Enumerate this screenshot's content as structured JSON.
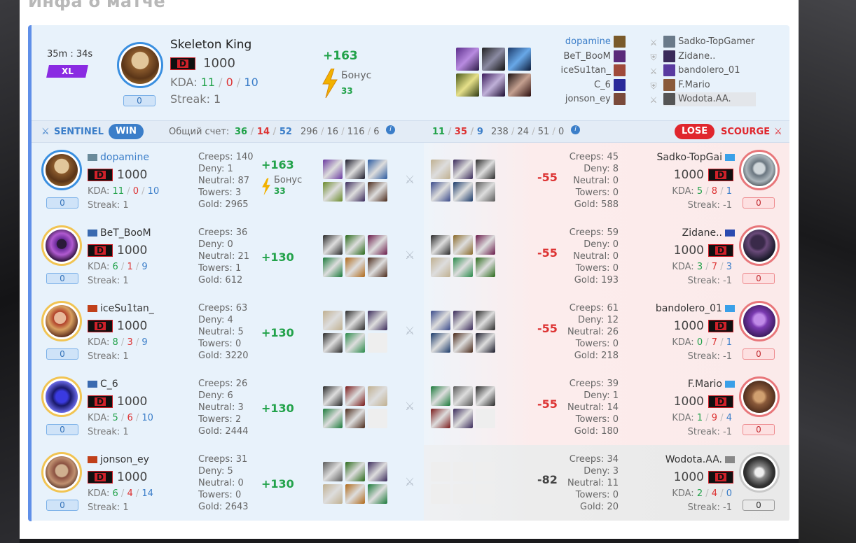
{
  "page_title": "Инфа о матче",
  "summary": {
    "duration": "35m : 34s",
    "xl_label": "XL",
    "hero_name": "Skeleton King",
    "rank_letter": "D",
    "rating": "1000",
    "kda_label": "KDA:",
    "kda": {
      "k": "11",
      "d": "0",
      "a": "10"
    },
    "streak": "Streak: 1",
    "level": "0",
    "points": "+163",
    "bonus_label": "Бонус",
    "bonus_value": "33"
  },
  "roster": {
    "sentinel": [
      "dopamine",
      "BeT_BooM",
      "iceSu1tan_",
      "C_6",
      "jonson_ey"
    ],
    "scourge": [
      "Sadko-TopGamer",
      "Zidane..",
      "bandolero_01",
      "F.Mario",
      "Wodota.AA."
    ]
  },
  "header": {
    "sentinel_label": "SENTINEL",
    "win_label": "WIN",
    "score_label": "Общий счет:",
    "sentinel_kda": {
      "k": "36",
      "d": "14",
      "a": "52"
    },
    "sentinel_stats": {
      "c": "296",
      "d": "16",
      "n": "116",
      "t": "6"
    },
    "scourge_kda": {
      "k": "11",
      "d": "35",
      "a": "9"
    },
    "scourge_stats": {
      "c": "238",
      "d": "24",
      "n": "51",
      "t": "0"
    },
    "lose_label": "LOSE",
    "scourge_label": "SCOURGE"
  },
  "labels": {
    "creeps": "Creeps:",
    "deny": "Deny:",
    "neutral": "Neutral:",
    "towers": "Towers:",
    "gold": "Gold:",
    "kda": "KDA:",
    "streak": "Streak:",
    "bonus": "Бонус"
  },
  "players": [
    {
      "left": {
        "name": "dopamine",
        "rank": "D",
        "rating": "1000",
        "k": "11",
        "d": "0",
        "a": "10",
        "streak": "1",
        "level": "0",
        "creeps": "140",
        "deny": "1",
        "neutral": "87",
        "towers": "3",
        "gold": "2965"
      },
      "delta": "+163",
      "bonus": "33",
      "rdelta": "-55",
      "right": {
        "name": "Sadko-TopGai",
        "rank": "D",
        "rating": "1000",
        "k": "5",
        "d": "8",
        "a": "1",
        "streak": "-1",
        "level": "0",
        "creeps": "45",
        "deny": "8",
        "neutral": "0",
        "towers": "0",
        "gold": "588"
      }
    },
    {
      "left": {
        "name": "BeT_BooM",
        "rank": "D",
        "rating": "1000",
        "k": "6",
        "d": "1",
        "a": "9",
        "streak": "1",
        "level": "0",
        "creeps": "36",
        "deny": "0",
        "neutral": "21",
        "towers": "1",
        "gold": "612"
      },
      "delta": "+130",
      "rdelta": "-55",
      "right": {
        "name": "Zidane..",
        "rank": "D",
        "rating": "1000",
        "k": "3",
        "d": "7",
        "a": "3",
        "streak": "-1",
        "level": "0",
        "creeps": "59",
        "deny": "0",
        "neutral": "0",
        "towers": "0",
        "gold": "193"
      }
    },
    {
      "left": {
        "name": "iceSu1tan_",
        "rank": "D",
        "rating": "1000",
        "k": "8",
        "d": "3",
        "a": "9",
        "streak": "1",
        "level": "0",
        "creeps": "63",
        "deny": "4",
        "neutral": "5",
        "towers": "0",
        "gold": "3220"
      },
      "delta": "+130",
      "rdelta": "-55",
      "right": {
        "name": "bandolero_01",
        "rank": "D",
        "rating": "1000",
        "k": "0",
        "d": "7",
        "a": "1",
        "streak": "-1",
        "level": "0",
        "creeps": "61",
        "deny": "12",
        "neutral": "26",
        "towers": "0",
        "gold": "218"
      }
    },
    {
      "left": {
        "name": "C_6",
        "rank": "D",
        "rating": "1000",
        "k": "5",
        "d": "6",
        "a": "10",
        "streak": "1",
        "level": "0",
        "creeps": "26",
        "deny": "6",
        "neutral": "3",
        "towers": "2",
        "gold": "2444"
      },
      "delta": "+130",
      "rdelta": "-55",
      "right": {
        "name": "F.Mario",
        "rank": "D",
        "rating": "1000",
        "k": "1",
        "d": "9",
        "a": "4",
        "streak": "-1",
        "level": "0",
        "creeps": "39",
        "deny": "1",
        "neutral": "14",
        "towers": "0",
        "gold": "180"
      }
    },
    {
      "left": {
        "name": "jonson_ey",
        "rank": "D",
        "rating": "1000",
        "k": "6",
        "d": "4",
        "a": "14",
        "streak": "1",
        "level": "0",
        "creeps": "31",
        "deny": "5",
        "neutral": "0",
        "towers": "0",
        "gold": "2643"
      },
      "delta": "+130",
      "rdelta": "-82",
      "right": {
        "name": "Wodota.AA.",
        "rank": "D",
        "rating": "1000",
        "k": "2",
        "d": "4",
        "a": "0",
        "streak": "-1",
        "level": "0",
        "creeps": "34",
        "deny": "3",
        "neutral": "11",
        "towers": "0",
        "gold": "20"
      }
    }
  ],
  "colors": {
    "accent": "#3b7ec9",
    "win": "#3b7ec9",
    "lose": "#e0262d",
    "positive": "#22a24a",
    "negative": "#d33",
    "sentinel_bg": "#e8f2fb",
    "scourge_bg": "#fbeaea"
  }
}
